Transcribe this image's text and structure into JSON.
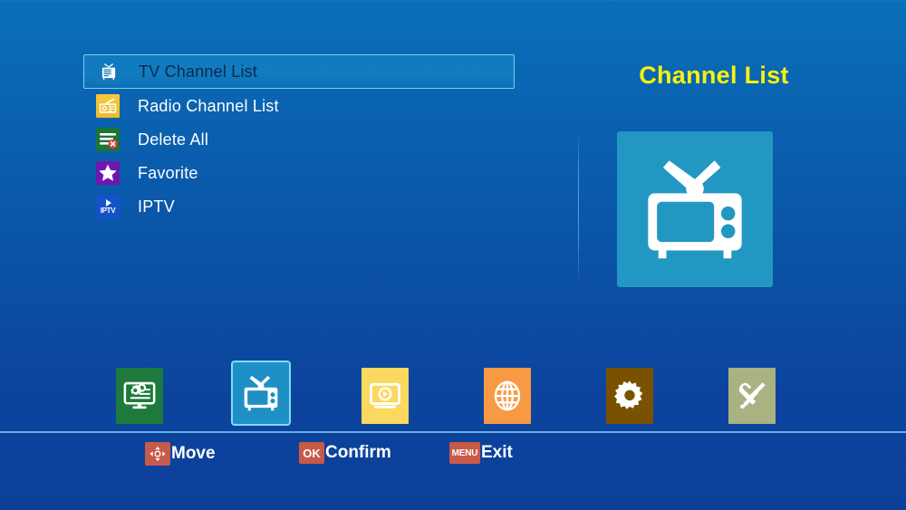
{
  "screen": {
    "title": "Channel List",
    "title_color": "#fbf20d",
    "background_top_color": "#0a6fb8",
    "background_bottom_color": "#0d3f99"
  },
  "menu": {
    "selected_index": 0,
    "items": [
      {
        "label": "TV Channel List",
        "icon": "tv-icon",
        "icon_color": "#1379bd",
        "selected": true
      },
      {
        "label": "Radio Channel List",
        "icon": "radio-icon",
        "icon_color": "#f0c02e",
        "selected": false
      },
      {
        "label": "Delete All",
        "icon": "delete-list-icon",
        "icon_color": "#1b7536",
        "selected": false
      },
      {
        "label": "Favorite",
        "icon": "star-icon",
        "icon_color": "#6d17b0",
        "selected": false
      },
      {
        "label": "IPTV",
        "icon": "iptv-icon",
        "icon_color": "#1452c8",
        "selected": false
      }
    ]
  },
  "preview": {
    "icon": "tv-large-icon",
    "tile_color": "#2297c2"
  },
  "toolbar": {
    "selected_index": 1,
    "items": [
      {
        "name": "installation",
        "icon": "monitor-gears-icon",
        "tile_color": "#1d7a3c",
        "selected": false
      },
      {
        "name": "channel-list",
        "icon": "tv-icon",
        "tile_color": "#1f90c6",
        "selected": true
      },
      {
        "name": "media-player",
        "icon": "media-play-icon",
        "tile_color": "#fbd85f",
        "selected": false
      },
      {
        "name": "network",
        "icon": "globe-icon",
        "tile_color": "#f79a43",
        "selected": false
      },
      {
        "name": "settings",
        "icon": "gear-icon",
        "tile_color": "#7a5100",
        "selected": false
      },
      {
        "name": "tools",
        "icon": "tools-icon",
        "tile_color": "#a9b281",
        "selected": false
      }
    ]
  },
  "footer": {
    "key_color": "#c85a49",
    "hints": [
      {
        "key": "",
        "key_icon": "dpad-icon",
        "label": "Move"
      },
      {
        "key": "OK",
        "key_icon": "",
        "label": "Confirm"
      },
      {
        "key": "MENU",
        "key_icon": "",
        "label": "Exit"
      }
    ]
  }
}
